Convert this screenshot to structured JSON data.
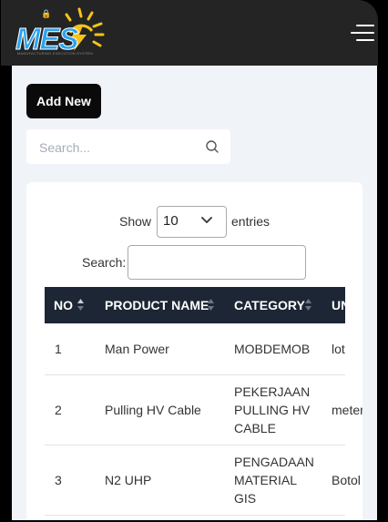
{
  "header": {
    "logo_text": "MES",
    "logo_tagline": "MANUFACTURING EXECUTION SYSTEM",
    "menu_icon": "hamburger-menu-icon"
  },
  "toolbar": {
    "add_new_label": "Add New",
    "search_placeholder": "Search...",
    "search_icon": "search-icon"
  },
  "table_controls": {
    "show_label": "Show",
    "entries_value": "10",
    "entries_label": "entries",
    "search_label": "Search:"
  },
  "table": {
    "columns": [
      "NO",
      "PRODUCT NAME",
      "CATEGORY",
      "UNIT"
    ],
    "rows": [
      {
        "no": "1",
        "product": "Man Power",
        "category": [
          "MOBDEMOB"
        ],
        "unit": "lot"
      },
      {
        "no": "2",
        "product": "Pulling HV Cable",
        "category": [
          "PEKERJAAN",
          "PULLING HV",
          "CABLE"
        ],
        "unit": "meter"
      },
      {
        "no": "3",
        "product": "N2 UHP",
        "category": [
          "PENGADAAN",
          "MATERIAL",
          "GIS"
        ],
        "unit": "Botol"
      }
    ]
  },
  "colors": {
    "header_bg": "#242424",
    "page_bg": "#f0f3f8",
    "table_head_bg": "#1d2634",
    "logo_blue": "#2aa3f0",
    "logo_yellow": "#f7c31a"
  }
}
